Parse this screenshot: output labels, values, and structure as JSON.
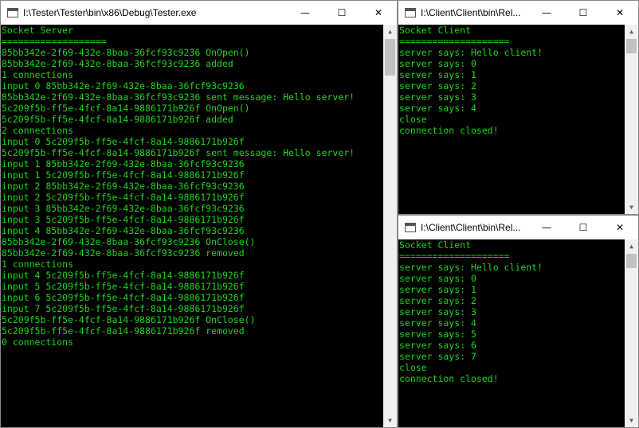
{
  "server_window": {
    "title": "I:\\Tester\\Tester\\bin\\x86\\Debug\\Tester.exe",
    "lines": [
      "Socket Server",
      "===================",
      "85bb342e-2f69-432e-8baa-36fcf93c9236 OnOpen()",
      "85bb342e-2f69-432e-8baa-36fcf93c9236 added",
      "1 connections",
      "input 0 85bb342e-2f69-432e-8baa-36fcf93c9236",
      "85bb342e-2f69-432e-8baa-36fcf93c9236 sent message: Hello server!",
      "5c209f5b-ff5e-4fcf-8a14-9886171b926f OnOpen()",
      "5c209f5b-ff5e-4fcf-8a14-9886171b926f added",
      "2 connections",
      "input 0 5c209f5b-ff5e-4fcf-8a14-9886171b926f",
      "5c209f5b-ff5e-4fcf-8a14-9886171b926f sent message: Hello server!",
      "input 1 85bb342e-2f69-432e-8baa-36fcf93c9236",
      "input 1 5c209f5b-ff5e-4fcf-8a14-9886171b926f",
      "input 2 85bb342e-2f69-432e-8baa-36fcf93c9236",
      "input 2 5c209f5b-ff5e-4fcf-8a14-9886171b926f",
      "input 3 85bb342e-2f69-432e-8baa-36fcf93c9236",
      "input 3 5c209f5b-ff5e-4fcf-8a14-9886171b926f",
      "input 4 85bb342e-2f69-432e-8baa-36fcf93c9236",
      "85bb342e-2f69-432e-8baa-36fcf93c9236 OnClose()",
      "85bb342e-2f69-432e-8baa-36fcf93c9236 removed",
      "1 connections",
      "input 4 5c209f5b-ff5e-4fcf-8a14-9886171b926f",
      "input 5 5c209f5b-ff5e-4fcf-8a14-9886171b926f",
      "input 6 5c209f5b-ff5e-4fcf-8a14-9886171b926f",
      "input 7 5c209f5b-ff5e-4fcf-8a14-9886171b926f",
      "5c209f5b-ff5e-4fcf-8a14-9886171b926f OnClose()",
      "5c209f5b-ff5e-4fcf-8a14-9886171b926f removed",
      "0 connections"
    ]
  },
  "client_window_1": {
    "title": "I:\\Client\\Client\\bin\\Rel...",
    "lines": [
      "Socket Client",
      "====================",
      "server says: Hello client!",
      "server says: 0",
      "server says: 1",
      "server says: 2",
      "server says: 3",
      "server says: 4",
      "close",
      "connection closed!"
    ]
  },
  "client_window_2": {
    "title": "I:\\Client\\Client\\bin\\Rel...",
    "lines": [
      "Socket Client",
      "====================",
      "server says: Hello client!",
      "server says: 0",
      "server says: 1",
      "server says: 2",
      "server says: 3",
      "server says: 4",
      "server says: 5",
      "server says: 6",
      "server says: 7",
      "close",
      "connection closed!"
    ]
  },
  "controls": {
    "minimize": "—",
    "maximize": "☐",
    "close": "✕",
    "scroll_up": "▲",
    "scroll_down": "▼"
  },
  "colors": {
    "console_text": "#17d617",
    "console_bg": "#000000",
    "titlebar_bg": "#ffffff"
  }
}
